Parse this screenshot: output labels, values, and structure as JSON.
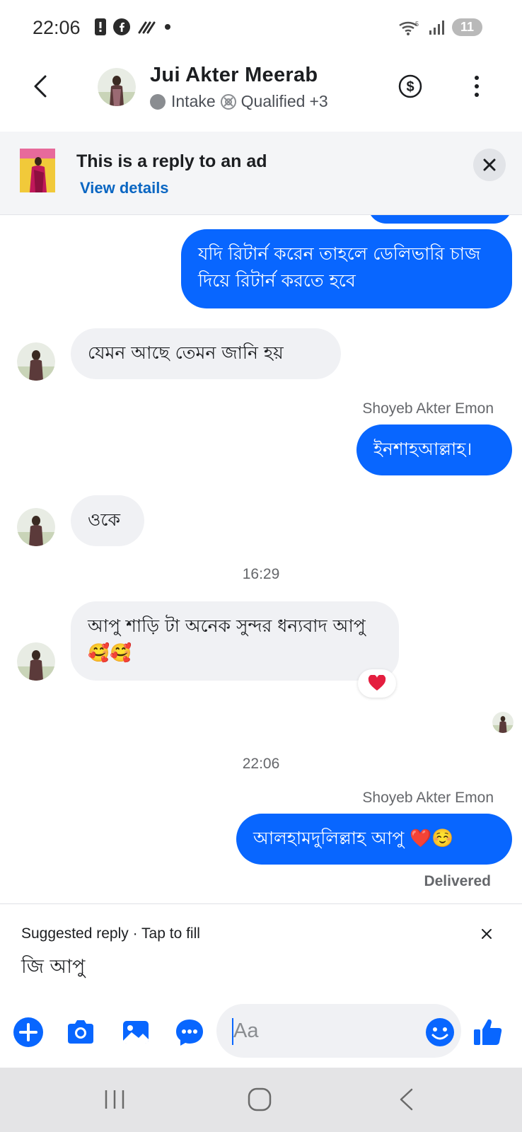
{
  "status_bar": {
    "time": "22:06",
    "battery_level": "11",
    "icons": [
      "alert-icon",
      "facebook-icon",
      "stylus-icon",
      "dot-icon",
      "wifi-icon",
      "signal-icon",
      "battery-icon"
    ]
  },
  "header": {
    "contact_name": "Jui Akter Meerab",
    "tag_1": "Intake",
    "tag_2": "Qualified",
    "tag_more": "+3"
  },
  "ad_banner": {
    "title": "This is a reply to an ad",
    "link": "View details"
  },
  "messages": [
    {
      "id": "m1",
      "direction": "out",
      "text": "যদি রিটার্ন করেন তাহলে ডেলিভারি চাজ দিয়ে রিটার্ন করতে হবে"
    },
    {
      "id": "m2",
      "direction": "in",
      "text": "যেমন আছে তেমন জানি হয়"
    },
    {
      "id": "m3",
      "direction": "out",
      "sender": "Shoyeb Akter Emon",
      "text": "ইনশাহআল্লাহ।"
    },
    {
      "id": "m4",
      "direction": "in",
      "text": "ওকে"
    },
    {
      "id": "sep1",
      "type": "time",
      "text": "16:29"
    },
    {
      "id": "m5",
      "direction": "in",
      "text": "আপু শাড়ি টা অনেক সুন্দর ধন্যবাদ আপু 🥰🥰",
      "reaction": "heart"
    },
    {
      "id": "sep2",
      "type": "time",
      "text": "22:06"
    },
    {
      "id": "m6",
      "direction": "out",
      "sender": "Shoyeb Akter Emon",
      "text": "আলহামদুলিল্লাহ আপু ❤️☺️",
      "status": "Delivered"
    }
  ],
  "suggestion": {
    "hint": "Suggested reply · Tap to fill",
    "text": "জি আপু"
  },
  "composer": {
    "placeholder": "Aa"
  },
  "colors": {
    "accent": "#0866ff",
    "incoming_bubble": "#f0f1f4",
    "link": "#0a66c2",
    "heart": "#e41e3f"
  }
}
